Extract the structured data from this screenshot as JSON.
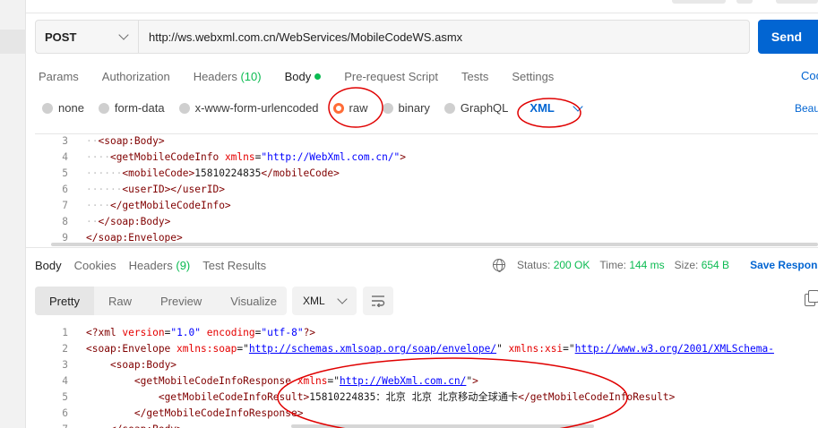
{
  "request": {
    "method": "POST",
    "url": "http://ws.webxml.com.cn/WebServices/MobileCodeWS.asmx",
    "send_label": "Send",
    "tabs": [
      {
        "label": "Params"
      },
      {
        "label": "Authorization"
      },
      {
        "label": "Headers",
        "count": "(10)"
      },
      {
        "label": "Body"
      },
      {
        "label": "Pre-request Script"
      },
      {
        "label": "Tests"
      },
      {
        "label": "Settings"
      }
    ],
    "cookies_label": "Coo",
    "body_types": [
      "none",
      "form-data",
      "x-www-form-urlencoded",
      "raw",
      "binary",
      "GraphQL"
    ],
    "selected_body_type": "raw",
    "language": "XML",
    "beautify_label": "Beau",
    "editor_lines": [
      {
        "n": "3",
        "indent": "··",
        "parts": [
          [
            "tag",
            "<soap:Body>"
          ]
        ]
      },
      {
        "n": "4",
        "indent": "····",
        "parts": [
          [
            "tag",
            "<getMobileCodeInfo "
          ],
          [
            "attr",
            "xmlns"
          ],
          [
            "txt",
            "="
          ],
          [
            "val",
            "\"http://WebXml.com.cn/\""
          ],
          [
            "tag",
            ">"
          ]
        ]
      },
      {
        "n": "5",
        "indent": "······",
        "parts": [
          [
            "tag",
            "<mobileCode>"
          ],
          [
            "txt",
            "15810224835"
          ],
          [
            "tag",
            "</mobileCode>"
          ]
        ]
      },
      {
        "n": "6",
        "indent": "······",
        "parts": [
          [
            "tag",
            "<userID></userID>"
          ]
        ]
      },
      {
        "n": "7",
        "indent": "····",
        "parts": [
          [
            "tag",
            "</getMobileCodeInfo>"
          ]
        ]
      },
      {
        "n": "8",
        "indent": "··",
        "parts": [
          [
            "tag",
            "</soap:Body>"
          ]
        ]
      },
      {
        "n": "9",
        "indent": "",
        "parts": [
          [
            "tag",
            "</soap:Envelope>"
          ]
        ]
      }
    ]
  },
  "response": {
    "tabs": [
      {
        "label": "Body"
      },
      {
        "label": "Cookies"
      },
      {
        "label": "Headers",
        "count": "(9)"
      },
      {
        "label": "Test Results"
      }
    ],
    "status_label": "Status:",
    "status_value": "200 OK",
    "time_label": "Time:",
    "time_value": "144 ms",
    "size_label": "Size:",
    "size_value": "654 B",
    "save_label": "Save Respons",
    "view_tabs": [
      "Pretty",
      "Raw",
      "Preview",
      "Visualize"
    ],
    "format": "XML",
    "editor_lines": [
      {
        "n": "1",
        "indent": "",
        "parts": [
          [
            "tag",
            "<?xml "
          ],
          [
            "attr",
            "version"
          ],
          [
            "txt",
            "="
          ],
          [
            "val",
            "\"1.0\""
          ],
          [
            "txt",
            " "
          ],
          [
            "attr",
            "encoding"
          ],
          [
            "txt",
            "="
          ],
          [
            "val",
            "\"utf-8\""
          ],
          [
            "tag",
            "?>"
          ]
        ]
      },
      {
        "n": "2",
        "indent": "",
        "parts": [
          [
            "tag",
            "<soap:Envelope "
          ],
          [
            "attr",
            "xmlns:soap"
          ],
          [
            "txt",
            "="
          ],
          [
            "txt",
            "\""
          ],
          [
            "lnk",
            "http://schemas.xmlsoap.org/soap/envelope/"
          ],
          [
            "txt",
            "\" "
          ],
          [
            "attr",
            "xmlns:xsi"
          ],
          [
            "txt",
            "="
          ],
          [
            "txt",
            "\""
          ],
          [
            "lnk",
            "http://www.w3.org/2001/XMLSchema-"
          ]
        ]
      },
      {
        "n": "3",
        "indent": "    ",
        "parts": [
          [
            "tag",
            "<soap:Body>"
          ]
        ]
      },
      {
        "n": "4",
        "indent": "        ",
        "parts": [
          [
            "tag",
            "<getMobileCodeInfoResponse "
          ],
          [
            "attr",
            "xmlns"
          ],
          [
            "txt",
            "="
          ],
          [
            "txt",
            "\""
          ],
          [
            "lnk",
            "http://WebXml.com.cn/"
          ],
          [
            "txt",
            "\""
          ],
          [
            "tag",
            ">"
          ]
        ]
      },
      {
        "n": "5",
        "indent": "            ",
        "parts": [
          [
            "tag",
            "<getMobileCodeInfoResult>"
          ],
          [
            "txt",
            "15810224835：北京 北京 北京移动全球通卡"
          ],
          [
            "tag",
            "</getMobileCodeInfoResult>"
          ]
        ]
      },
      {
        "n": "6",
        "indent": "        ",
        "parts": [
          [
            "tag",
            "</getMobileCodeInfoResponse>"
          ]
        ]
      },
      {
        "n": "7",
        "indent": "    ",
        "parts": [
          [
            "tag",
            "</soap:Body>"
          ]
        ]
      }
    ]
  },
  "colors": {
    "send": "#0265d2",
    "accent_orange": "#ff6c37",
    "status_green": "#0cbb52",
    "annotation_red": "#e00000"
  }
}
